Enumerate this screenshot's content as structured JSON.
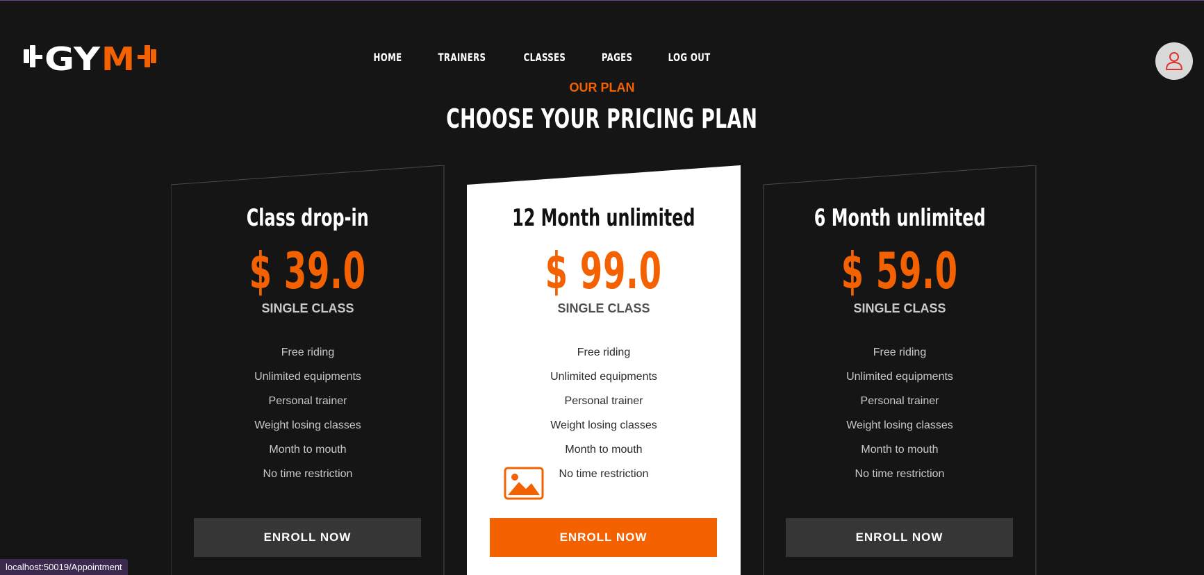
{
  "logo": {
    "text_white": "GY",
    "text_orange": "M"
  },
  "nav": {
    "items": [
      "HOME",
      "TRAINERS",
      "CLASSES",
      "PAGES",
      "LOG OUT"
    ]
  },
  "header": {
    "user_icon": "user-icon"
  },
  "section": {
    "subtitle": "OUR PLAN",
    "title": "CHOOSE YOUR PRICING PLAN"
  },
  "plans": [
    {
      "name": "Class drop-in",
      "price": "$ 39.0",
      "period": "SINGLE CLASS",
      "features": [
        "Free riding",
        "Unlimited equipments",
        "Personal trainer",
        "Weight losing classes",
        "Month to mouth",
        "No time restriction"
      ],
      "button": "ENROLL NOW"
    },
    {
      "name": "12 Month unlimited",
      "price": "$ 99.0",
      "period": "SINGLE CLASS",
      "features": [
        "Free riding",
        "Unlimited equipments",
        "Personal trainer",
        "Weight losing classes",
        "Month to mouth",
        "No time restriction"
      ],
      "button": "ENROLL NOW"
    },
    {
      "name": "6 Month unlimited",
      "price": "$ 59.0",
      "period": "SINGLE CLASS",
      "features": [
        "Free riding",
        "Unlimited equipments",
        "Personal trainer",
        "Weight losing classes",
        "Month to mouth",
        "No time restriction"
      ],
      "button": "ENROLL NOW"
    }
  ],
  "status_bar": {
    "url": "localhost:50019/Appointment"
  },
  "colors": {
    "accent": "#f36100",
    "background": "#151515",
    "card_dark": "#151515",
    "card_featured": "#ffffff",
    "button_dark": "#363636"
  }
}
